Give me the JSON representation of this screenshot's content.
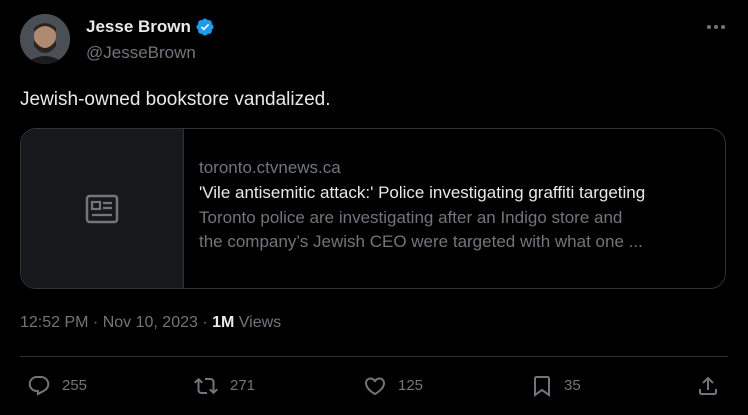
{
  "author": {
    "display_name": "Jesse Brown",
    "handle": "@JesseBrown",
    "verified": true
  },
  "tweet": {
    "text": "Jewish-owned bookstore vandalized."
  },
  "card": {
    "domain": "toronto.ctvnews.ca",
    "title": "'Vile antisemitic attack:' Police investigating graffiti targeting",
    "description_line1": "Toronto police are investigating after an Indigo store and",
    "description_line2": "the company’s Jewish CEO were targeted with what one ...",
    "icon": "article-icon"
  },
  "meta": {
    "time": "12:52 PM",
    "separator": " · ",
    "date": "Nov 10, 2023",
    "views_count": "1M",
    "views_label": " Views"
  },
  "actions": {
    "replies": "255",
    "reposts": "271",
    "likes": "125",
    "bookmarks": "35"
  },
  "colors": {
    "background": "#000000",
    "text": "#e7e9ea",
    "secondary": "#71767b",
    "border": "#2f3336",
    "verified": "#1d9bf0"
  }
}
